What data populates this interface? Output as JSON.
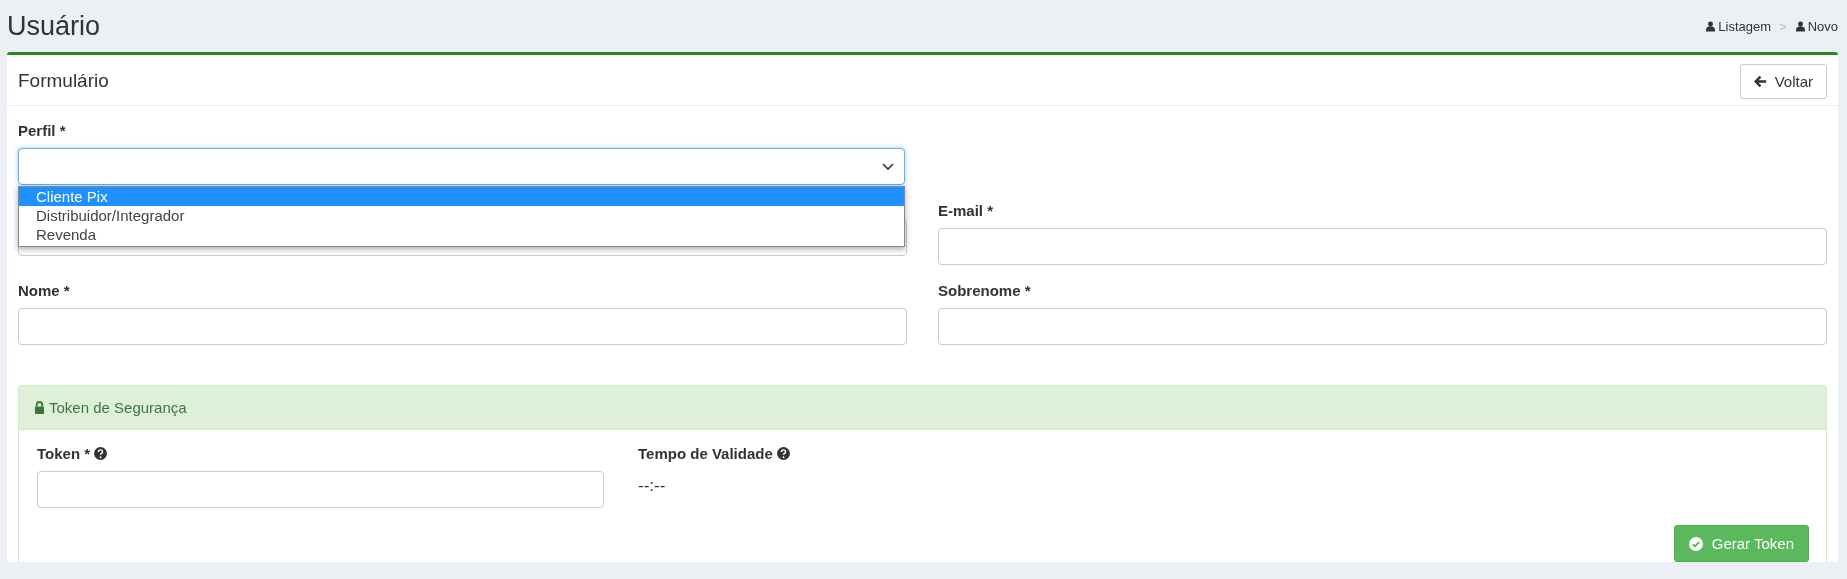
{
  "page": {
    "title": "Usuário",
    "breadcrumb": [
      {
        "label": "Listagem"
      },
      {
        "label": "Novo"
      }
    ],
    "separator": ">"
  },
  "panel": {
    "title": "Formulário",
    "back_button": "Voltar"
  },
  "profile": {
    "label": "Perfil *",
    "expanded": true,
    "options": [
      {
        "label": "Cliente Pix",
        "selected": true
      },
      {
        "label": "Distribuidor/Integrador",
        "selected": false
      },
      {
        "label": "Revenda",
        "selected": false
      }
    ]
  },
  "fields": [
    {
      "kind": "text"
    },
    {
      "kind": "text",
      "label": "E-mail *"
    },
    {
      "kind": "text",
      "label": "Nome *"
    },
    {
      "kind": "text",
      "label": "Sobrenome *"
    }
  ],
  "token": {
    "title": "Token de Segurança",
    "token_label": "Token *",
    "validity_label": "Tempo de Validade",
    "validity_value": "--:--",
    "button": "Gerar Token"
  }
}
